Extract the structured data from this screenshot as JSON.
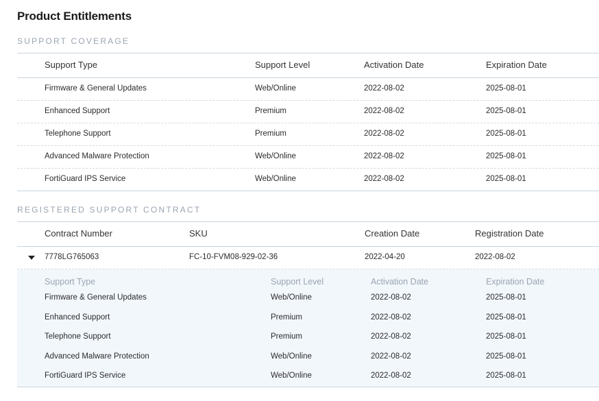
{
  "page": {
    "title": "Product Entitlements"
  },
  "coverage": {
    "section_title": "SUPPORT COVERAGE",
    "headers": {
      "type": "Support Type",
      "level": "Support Level",
      "activation": "Activation Date",
      "expiration": "Expiration Date"
    },
    "rows": [
      {
        "type": "Firmware & General Updates",
        "level": "Web/Online",
        "activation": "2022-08-02",
        "expiration": "2025-08-01"
      },
      {
        "type": "Enhanced Support",
        "level": "Premium",
        "activation": "2022-08-02",
        "expiration": "2025-08-01"
      },
      {
        "type": "Telephone Support",
        "level": "Premium",
        "activation": "2022-08-02",
        "expiration": "2025-08-01"
      },
      {
        "type": "Advanced Malware Protection",
        "level": "Web/Online",
        "activation": "2022-08-02",
        "expiration": "2025-08-01"
      },
      {
        "type": "FortiGuard IPS Service",
        "level": "Web/Online",
        "activation": "2022-08-02",
        "expiration": "2025-08-01"
      }
    ]
  },
  "contract": {
    "section_title": "REGISTERED SUPPORT CONTRACT",
    "headers": {
      "number": "Contract Number",
      "sku": "SKU",
      "creation": "Creation Date",
      "registration": "Registration Date"
    },
    "row": {
      "number": "7778LG765063",
      "sku": "FC-10-FVM08-929-02-36",
      "creation": "2022-04-20",
      "registration": "2022-08-02",
      "expander_icon": "caret-down-icon"
    },
    "details": {
      "headers": {
        "type": "Support Type",
        "level": "Support Level",
        "activation": "Activation Date",
        "expiration": "Expiration Date"
      },
      "rows": [
        {
          "type": "Firmware & General Updates",
          "level": "Web/Online",
          "activation": "2022-08-02",
          "expiration": "2025-08-01"
        },
        {
          "type": "Enhanced Support",
          "level": "Premium",
          "activation": "2022-08-02",
          "expiration": "2025-08-01"
        },
        {
          "type": "Telephone Support",
          "level": "Premium",
          "activation": "2022-08-02",
          "expiration": "2025-08-01"
        },
        {
          "type": "Advanced Malware Protection",
          "level": "Web/Online",
          "activation": "2022-08-02",
          "expiration": "2025-08-01"
        },
        {
          "type": "FortiGuard IPS Service",
          "level": "Web/Online",
          "activation": "2022-08-02",
          "expiration": "2025-08-01"
        }
      ]
    }
  },
  "colors": {
    "section_title": "#9aa4b0",
    "detail_background": "#f2f7fc",
    "rule": "#c9d3dd"
  }
}
